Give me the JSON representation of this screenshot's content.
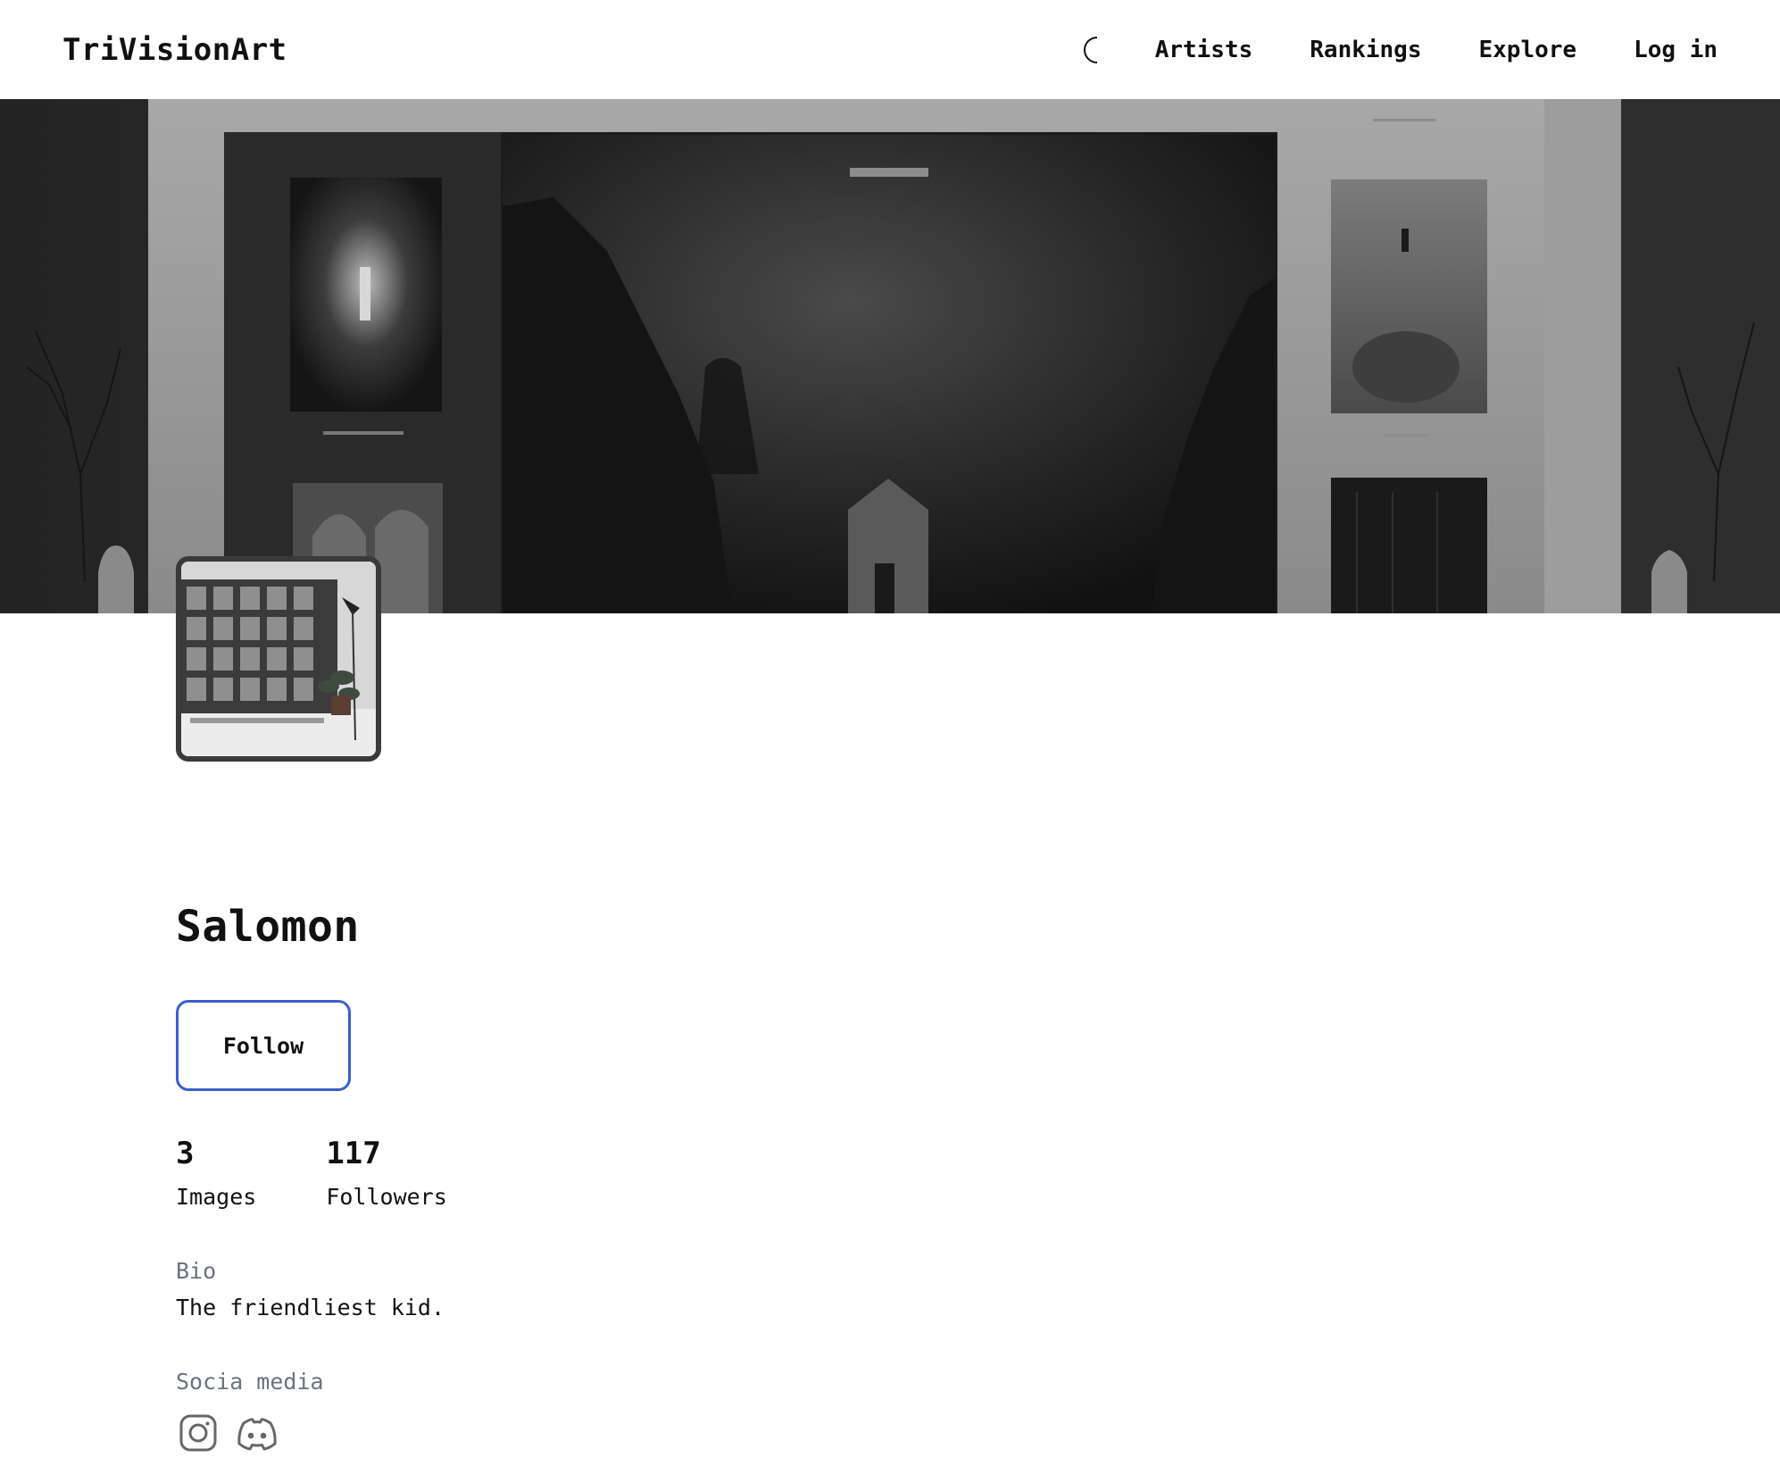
{
  "nav": {
    "brand": "TriVisionArt",
    "theme_icon": "moon-icon",
    "links": [
      "Artists",
      "Rankings",
      "Explore",
      "Log in"
    ]
  },
  "profile": {
    "name": "Salomon",
    "follow_label": "Follow",
    "stats": [
      {
        "value": "3",
        "label": "Images"
      },
      {
        "value": "117",
        "label": "Followers"
      }
    ],
    "bio_label": "Bio",
    "bio": "The friendliest kid.",
    "social_label": "Socia media",
    "social_icons": [
      "instagram-icon",
      "discord-icon"
    ]
  },
  "colors": {
    "follow_border": "#3a5fcd",
    "muted_label": "#6b7280"
  }
}
